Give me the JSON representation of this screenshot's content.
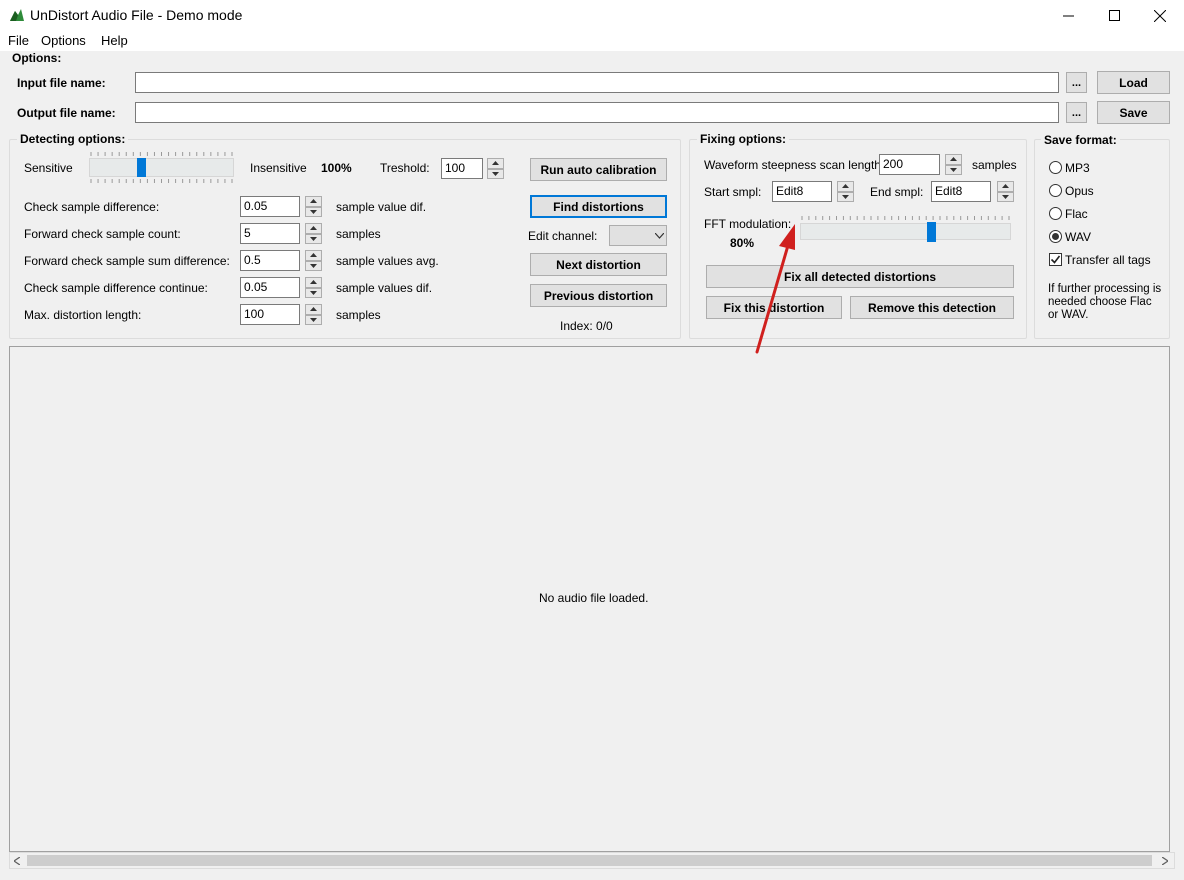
{
  "window": {
    "title": "UnDistort Audio File - Demo mode",
    "controls": {
      "minimize": "—",
      "maximize": "☐",
      "close": "✕"
    }
  },
  "menu": {
    "items": [
      "File",
      "Options",
      "Help"
    ]
  },
  "options_group": {
    "label": "Options:",
    "input_label": "Input file name:",
    "input_value": "",
    "output_label": "Output file name:",
    "output_value": "",
    "browse_label": "...",
    "load_label": "Load",
    "save_label": "Save"
  },
  "detecting": {
    "label": "Detecting options:",
    "sensitive": "Sensitive",
    "insensitive": "Insensitive",
    "sensitivity_value": "100%",
    "sensitivity_level": 0.35,
    "treshold_label": "Treshold:",
    "treshold_value": "100",
    "rows": [
      {
        "label": "Check sample difference:",
        "value": "0.05",
        "unit": "sample value dif."
      },
      {
        "label": "Forward check sample count:",
        "value": "5",
        "unit": "samples"
      },
      {
        "label": "Forward check sample sum difference:",
        "value": "0.5",
        "unit": "sample values avg."
      },
      {
        "label": "Check sample difference continue:",
        "value": "0.05",
        "unit": "sample values dif."
      },
      {
        "label": "Max. distortion length:",
        "value": "100",
        "unit": "samples"
      }
    ],
    "run_auto_calibration": "Run auto calibration",
    "find_distortions": "Find distortions",
    "edit_channel": "Edit channel:",
    "next_distortion": "Next distortion",
    "previous_distortion": "Previous distortion",
    "index": "Index: 0/0"
  },
  "fixing": {
    "label": "Fixing options:",
    "waveform_label": "Waveform steepness scan length:",
    "waveform_value": "200",
    "waveform_unit": "samples",
    "start_label": "Start smpl:",
    "start_value": "Edit8",
    "end_label": "End smpl:",
    "end_value": "Edit8",
    "fft_label": "FFT modulation:",
    "fft_value": "80%",
    "fft_level": 0.63,
    "fix_all": "Fix all detected distortions",
    "fix_this": "Fix this distortion",
    "remove_this": "Remove this detection"
  },
  "save_format": {
    "label": "Save format:",
    "options": [
      "MP3",
      "Opus",
      "Flac",
      "WAV"
    ],
    "selected": "WAV",
    "transfer_tags": "Transfer all tags",
    "note": "If further processing is needed choose Flac or WAV."
  },
  "main_panel": {
    "message": "No audio file loaded."
  },
  "colors": {
    "accent": "#0078d7",
    "annotation_arrow": "#d0201e"
  }
}
